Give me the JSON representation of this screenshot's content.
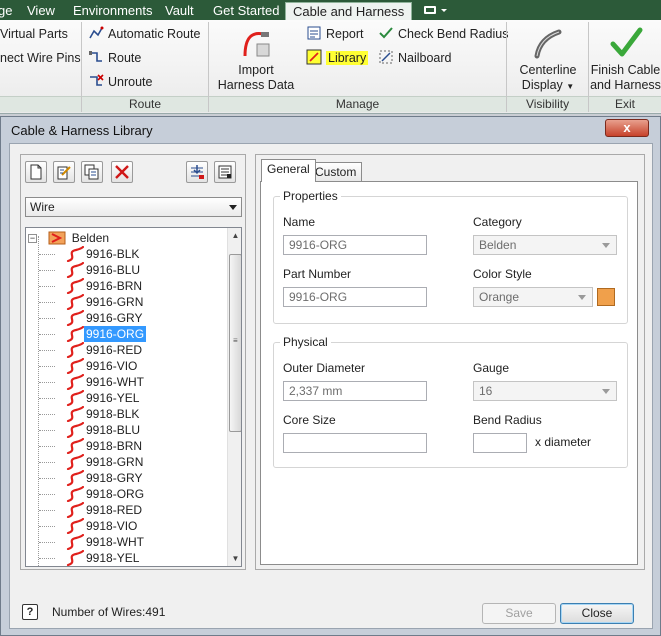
{
  "ribbon": {
    "tabs": [
      {
        "label": "ge",
        "active": false
      },
      {
        "label": "View",
        "active": false
      },
      {
        "label": "Environments",
        "active": false
      },
      {
        "label": "Vault",
        "active": false
      },
      {
        "label": "Get Started",
        "active": false
      },
      {
        "label": "Cable and Harness",
        "active": true
      }
    ],
    "extra_icon": "monitor-icon",
    "left_items": [
      "Virtual Parts",
      "nect Wire Pins"
    ],
    "route_panel": {
      "title": "Route",
      "items": [
        "Automatic Route",
        "Route",
        "Unroute"
      ]
    },
    "manage_panel": {
      "title": "Manage",
      "import_label_1": "Import",
      "import_label_2": "Harness Data",
      "items": [
        "Report",
        "Library",
        "Check Bend Radius",
        "Nailboard"
      ]
    },
    "visibility_panel": {
      "title": "Visibility",
      "label_1": "Centerline",
      "label_2": "Display"
    },
    "exit_panel": {
      "title": "Exit",
      "label_1": "Finish Cable",
      "label_2": "and Harness"
    }
  },
  "dialog": {
    "title": "Cable & Harness Library",
    "close_label": "x",
    "type_select": "Wire",
    "tree": {
      "root": "Belden",
      "items": [
        "9916-BLK",
        "9916-BLU",
        "9916-BRN",
        "9916-GRN",
        "9916-GRY",
        "9916-ORG",
        "9916-RED",
        "9916-VIO",
        "9916-WHT",
        "9916-YEL",
        "9918-BLK",
        "9918-BLU",
        "9918-BRN",
        "9918-GRN",
        "9918-GRY",
        "9918-ORG",
        "9918-RED",
        "9918-VIO",
        "9918-WHT",
        "9918-YEL"
      ],
      "selected": "9916-ORG"
    },
    "tabs": [
      "General",
      "Custom"
    ],
    "properties": {
      "title": "Properties",
      "name_label": "Name",
      "name_value": "9916-ORG",
      "category_label": "Category",
      "category_value": "Belden",
      "part_number_label": "Part Number",
      "part_number_value": "9916-ORG",
      "color_style_label": "Color Style",
      "color_style_value": "Orange",
      "color_swatch": "#f0a04b"
    },
    "physical": {
      "title": "Physical",
      "outer_diameter_label": "Outer Diameter",
      "outer_diameter_value": "2,337 mm",
      "gauge_label": "Gauge",
      "gauge_value": "16",
      "core_size_label": "Core Size",
      "core_size_value": "",
      "bend_radius_label": "Bend Radius",
      "bend_radius_value": "",
      "bend_radius_unit": "x diameter"
    },
    "footer": {
      "help_label": "?",
      "wire_count": "Number of Wires:491",
      "save_label": "Save",
      "close_label": "Close"
    }
  },
  "colors": {
    "tab_bar": "#2c5a39",
    "selection": "#3399ff",
    "wire_icon": "#e0201c"
  }
}
